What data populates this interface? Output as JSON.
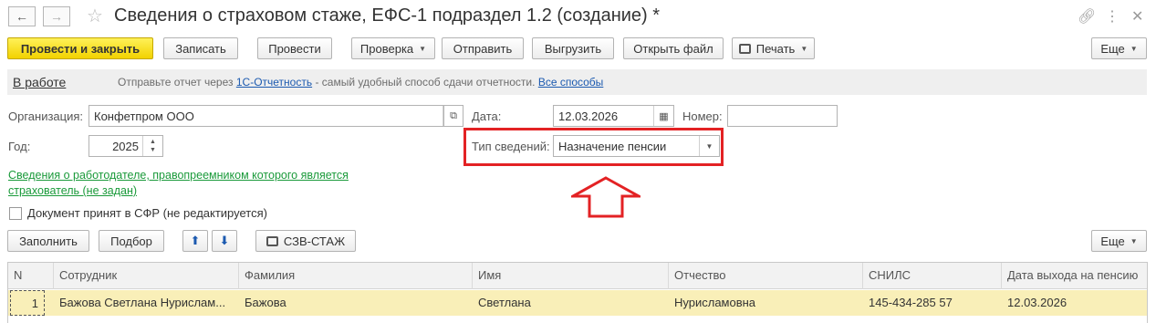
{
  "window": {
    "title": "Сведения о страховом стаже, ЕФС-1 подраздел 1.2 (создание) *"
  },
  "toolbar": {
    "post_close": "Провести и закрыть",
    "save": "Записать",
    "post": "Провести",
    "check": "Проверка",
    "send": "Отправить",
    "export": "Выгрузить",
    "open_file": "Открыть файл",
    "print": "Печать",
    "more": "Еще"
  },
  "infobar": {
    "status": "В работе",
    "text_prefix": "Отправьте отчет через",
    "link_1c": "1С-Отчетность",
    "text_middle": "- самый удобный способ сдачи отчетности.",
    "link_all": "Все способы"
  },
  "form": {
    "org_label": "Организация:",
    "org_value": "Конфетпром ООО",
    "date_label": "Дата:",
    "date_value": "12.03.2026",
    "number_label": "Номер:",
    "number_value": "",
    "year_label": "Год:",
    "year_value": "2025",
    "type_label": "Тип сведений:",
    "type_value": "Назначение пенсии",
    "successor_link": "Сведения о работодателе, правопреемником которого является страхователь (не задан)",
    "accepted_label": "Документ принят в СФР (не редактируется)"
  },
  "table_toolbar": {
    "fill": "Заполнить",
    "select": "Подбор",
    "szv": "СЗВ-СТАЖ",
    "more": "Еще"
  },
  "table": {
    "headers": [
      "N",
      "Сотрудник",
      "Фамилия",
      "Имя",
      "Отчество",
      "СНИЛС",
      "Дата выхода на пенсию"
    ],
    "rows": [
      [
        "1",
        "Бажова Светлана Нурислам...",
        "Бажова",
        "Светлана",
        "Нурисламовна",
        "145-434-285 57",
        "12.03.2026"
      ]
    ]
  },
  "colors": {
    "primary_button": "#f2d200",
    "highlight": "#e32224",
    "green_link": "#1a9a3a",
    "selected_row": "#f9efb8"
  }
}
